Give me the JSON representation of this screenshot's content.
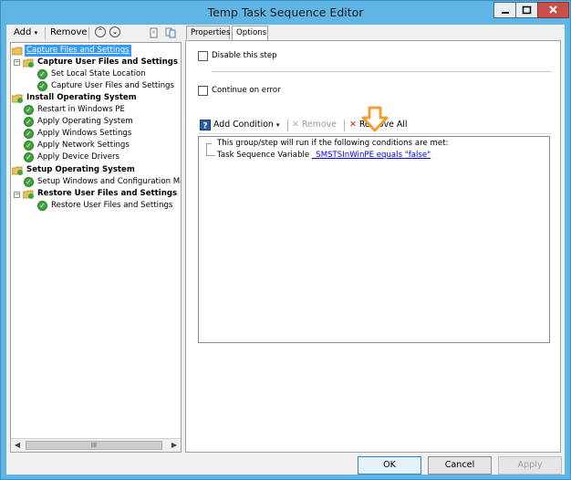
{
  "window": {
    "title": "Temp Task Sequence Editor"
  },
  "left_toolbar": {
    "add_label": "Add",
    "add_caret": "▾",
    "remove_label": "Remove"
  },
  "tree": {
    "root": "Capture Files and Settings",
    "group1": "Capture User Files and Settings",
    "group1_items": [
      "Set Local State Location",
      "Capture User Files and Settings"
    ],
    "group2": "Install Operating System",
    "group2_items": [
      "Restart in Windows PE",
      "Apply Operating System",
      "Apply Windows Settings",
      "Apply Network Settings",
      "Apply Device Drivers"
    ],
    "group3": "Setup Operating System",
    "group3_items": [
      "Setup Windows and Configuration Mar"
    ],
    "group4": "Restore User Files and Settings",
    "group4_items": [
      "Restore User Files and Settings"
    ],
    "scroll_thumb": "III"
  },
  "tabs": [
    {
      "label": "Properties"
    },
    {
      "label": "Options"
    }
  ],
  "options": {
    "disable_step": "Disable this step",
    "continue_on_error": "Continue on error",
    "add_condition": "Add Condition",
    "remove": "Remove",
    "remove_all": "Remove All",
    "cond_header": "This group/step will run if the following conditions are met:",
    "cond_prefix": "Task Sequence Variable",
    "cond_link": "_SMSTSInWinPE equals \"false\""
  },
  "buttons": {
    "ok": "OK",
    "cancel": "Cancel",
    "apply": "Apply"
  },
  "colors": {
    "accent": "#3399ff",
    "arrow": "#f0a030",
    "check_green": "#3fa53c",
    "remove_red": "#d42020"
  }
}
